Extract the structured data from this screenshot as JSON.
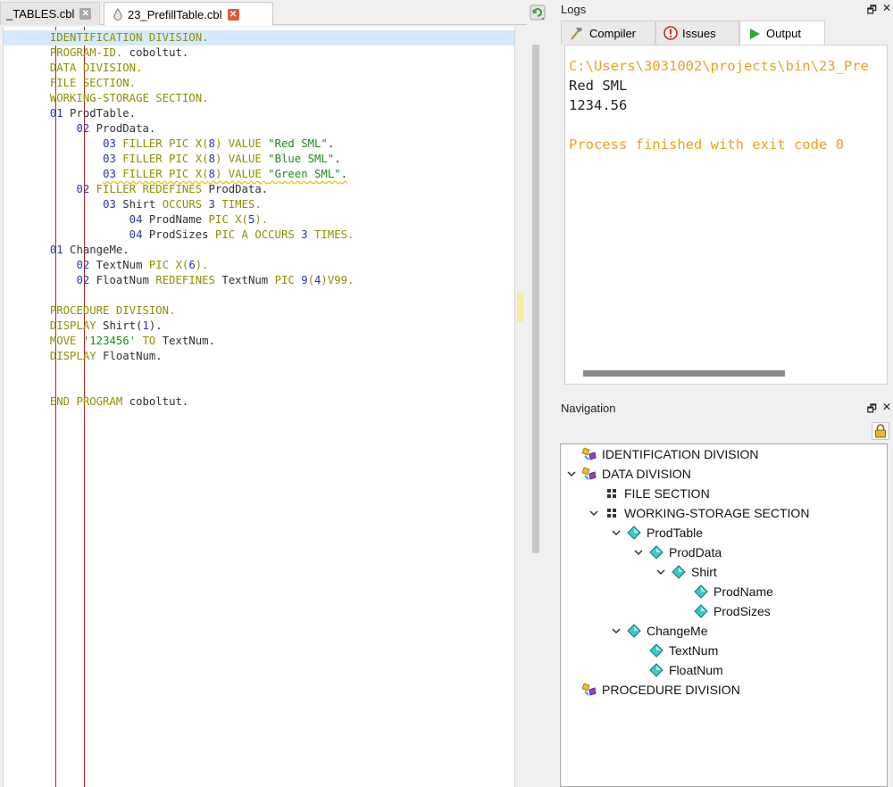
{
  "editor": {
    "tabs": [
      {
        "label": "_TABLES.cbl",
        "active": false
      },
      {
        "label": "23_PrefillTable.cbl",
        "active": true
      }
    ],
    "code": [
      {
        "tokens": [
          {
            "t": "       "
          },
          {
            "t": "IDENTIFICATION DIVISION.",
            "c": "kw"
          }
        ],
        "current": true
      },
      {
        "tokens": [
          {
            "t": "       "
          },
          {
            "t": "PROGRAM-ID.",
            "c": "kw"
          },
          {
            "t": " coboltut.",
            "c": "ident"
          }
        ]
      },
      {
        "tokens": [
          {
            "t": "       "
          },
          {
            "t": "DATA DIVISION.",
            "c": "kw"
          }
        ]
      },
      {
        "tokens": [
          {
            "t": "       "
          },
          {
            "t": "FILE SECTION.",
            "c": "kw"
          }
        ]
      },
      {
        "tokens": [
          {
            "t": "       "
          },
          {
            "t": "WORKING-STORAGE SECTION.",
            "c": "kw"
          }
        ]
      },
      {
        "tokens": [
          {
            "t": "       "
          },
          {
            "t": "01",
            "c": "num"
          },
          {
            "t": " ProdTable.",
            "c": "ident"
          }
        ]
      },
      {
        "tokens": [
          {
            "t": "           "
          },
          {
            "t": "02",
            "c": "num"
          },
          {
            "t": " ProdData.",
            "c": "ident"
          }
        ]
      },
      {
        "tokens": [
          {
            "t": "               "
          },
          {
            "t": "03",
            "c": "num"
          },
          {
            "t": " FILLER PIC X(",
            "c": "kw"
          },
          {
            "t": "8",
            "c": "num"
          },
          {
            "t": ") VALUE ",
            "c": "kw"
          },
          {
            "t": "\"Red SML\"",
            "c": "str"
          },
          {
            "t": ".",
            "c": "ident"
          }
        ]
      },
      {
        "tokens": [
          {
            "t": "               "
          },
          {
            "t": "03",
            "c": "num"
          },
          {
            "t": " FILLER PIC X(",
            "c": "kw"
          },
          {
            "t": "8",
            "c": "num"
          },
          {
            "t": ") VALUE ",
            "c": "kw"
          },
          {
            "t": "\"Blue SML\"",
            "c": "str"
          },
          {
            "t": ".",
            "c": "ident"
          }
        ]
      },
      {
        "tokens": [
          {
            "t": "               "
          },
          {
            "t": "03",
            "c": "num"
          },
          {
            "t": " FILLER PIC X(",
            "c": "kw"
          },
          {
            "t": "8",
            "c": "num"
          },
          {
            "t": ") VALUE ",
            "c": "kw"
          },
          {
            "t": "\"Green SML\"",
            "c": "str"
          },
          {
            "t": ".",
            "c": "ident"
          }
        ],
        "wavy": true
      },
      {
        "tokens": [
          {
            "t": "           "
          },
          {
            "t": "02",
            "c": "num"
          },
          {
            "t": " FILLER REDEFINES",
            "c": "kw"
          },
          {
            "t": " ProdData.",
            "c": "ident"
          }
        ]
      },
      {
        "tokens": [
          {
            "t": "               "
          },
          {
            "t": "03",
            "c": "num"
          },
          {
            "t": " Shirt ",
            "c": "ident"
          },
          {
            "t": "OCCURS ",
            "c": "kw"
          },
          {
            "t": "3",
            "c": "num"
          },
          {
            "t": " TIMES.",
            "c": "kw"
          }
        ]
      },
      {
        "tokens": [
          {
            "t": "                   "
          },
          {
            "t": "04",
            "c": "num"
          },
          {
            "t": " ProdName ",
            "c": "ident"
          },
          {
            "t": "PIC X(",
            "c": "kw"
          },
          {
            "t": "5",
            "c": "num"
          },
          {
            "t": ").",
            "c": "kw"
          }
        ]
      },
      {
        "tokens": [
          {
            "t": "                   "
          },
          {
            "t": "04",
            "c": "num"
          },
          {
            "t": " ProdSizes ",
            "c": "ident"
          },
          {
            "t": "PIC A OCCURS ",
            "c": "kw"
          },
          {
            "t": "3",
            "c": "num"
          },
          {
            "t": " TIMES.",
            "c": "kw"
          }
        ]
      },
      {
        "tokens": [
          {
            "t": "       "
          },
          {
            "t": "01",
            "c": "num"
          },
          {
            "t": " ChangeMe.",
            "c": "ident"
          }
        ]
      },
      {
        "tokens": [
          {
            "t": "           "
          },
          {
            "t": "02",
            "c": "num"
          },
          {
            "t": " TextNum ",
            "c": "ident"
          },
          {
            "t": "PIC X(",
            "c": "kw"
          },
          {
            "t": "6",
            "c": "num"
          },
          {
            "t": ").",
            "c": "kw"
          }
        ]
      },
      {
        "tokens": [
          {
            "t": "           "
          },
          {
            "t": "02",
            "c": "num"
          },
          {
            "t": " FloatNum ",
            "c": "ident"
          },
          {
            "t": "REDEFINES",
            "c": "kw"
          },
          {
            "t": " TextNum ",
            "c": "ident"
          },
          {
            "t": "PIC ",
            "c": "kw"
          },
          {
            "t": "9",
            "c": "num"
          },
          {
            "t": "(",
            "c": "kw"
          },
          {
            "t": "4",
            "c": "num"
          },
          {
            "t": ")V99.",
            "c": "kw"
          }
        ]
      },
      {
        "tokens": [
          {
            "t": ""
          }
        ]
      },
      {
        "tokens": [
          {
            "t": "       "
          },
          {
            "t": "PROCEDURE DIVISION.",
            "c": "kw"
          }
        ]
      },
      {
        "tokens": [
          {
            "t": "       "
          },
          {
            "t": "DISPLAY",
            "c": "kw"
          },
          {
            "t": " Shirt(",
            "c": "ident"
          },
          {
            "t": "1",
            "c": "num"
          },
          {
            "t": ").",
            "c": "ident"
          }
        ]
      },
      {
        "tokens": [
          {
            "t": "       "
          },
          {
            "t": "MOVE ",
            "c": "kw"
          },
          {
            "t": "'123456'",
            "c": "str"
          },
          {
            "t": " TO",
            "c": "kw"
          },
          {
            "t": " TextNum.",
            "c": "ident"
          }
        ]
      },
      {
        "tokens": [
          {
            "t": "       "
          },
          {
            "t": "DISPLAY",
            "c": "kw"
          },
          {
            "t": " FloatNum.",
            "c": "ident"
          }
        ]
      },
      {
        "tokens": [
          {
            "t": ""
          }
        ]
      },
      {
        "tokens": [
          {
            "t": ""
          }
        ]
      },
      {
        "tokens": [
          {
            "t": "       "
          },
          {
            "t": "END PROGRAM",
            "c": "kw"
          },
          {
            "t": " coboltut.",
            "c": "ident"
          }
        ]
      }
    ],
    "icons": {
      "refresh": "refresh-icon",
      "file": "file-drop-icon",
      "close": "close-icon"
    }
  },
  "logs": {
    "title": "Logs",
    "tabs": [
      {
        "label": "Compiler",
        "icon": "hammer-icon"
      },
      {
        "label": "Issues",
        "icon": "alert-icon"
      },
      {
        "label": "Output",
        "icon": "play-icon",
        "active": true
      }
    ],
    "output": [
      {
        "text": "C:\\Users\\3031002\\projects\\bin\\23_Pre",
        "color": "orange"
      },
      {
        "text": "Red SML",
        "color": "black"
      },
      {
        "text": "1234.56",
        "color": "black"
      },
      {
        "text": "",
        "color": "black"
      },
      {
        "text": "Process finished with exit code 0",
        "color": "orange"
      }
    ]
  },
  "navigation": {
    "title": "Navigation",
    "tree": [
      {
        "label": "IDENTIFICATION DIVISION",
        "level": 0,
        "icon": "division-icon",
        "expanded": null
      },
      {
        "label": "DATA DIVISION",
        "level": 0,
        "icon": "division-icon",
        "expanded": true
      },
      {
        "label": "FILE SECTION",
        "level": 1,
        "icon": "section-icon",
        "expanded": null
      },
      {
        "label": "WORKING-STORAGE SECTION",
        "level": 1,
        "icon": "section-icon",
        "expanded": true
      },
      {
        "label": "ProdTable",
        "level": 2,
        "icon": "field-icon",
        "expanded": true
      },
      {
        "label": "ProdData",
        "level": 3,
        "icon": "field-icon",
        "expanded": true
      },
      {
        "label": "Shirt",
        "level": 4,
        "icon": "field-icon",
        "expanded": true
      },
      {
        "label": "ProdName",
        "level": 5,
        "icon": "field-icon",
        "expanded": null
      },
      {
        "label": "ProdSizes",
        "level": 5,
        "icon": "field-icon",
        "expanded": null
      },
      {
        "label": "ChangeMe",
        "level": 2,
        "icon": "field-icon",
        "expanded": true
      },
      {
        "label": "TextNum",
        "level": 3,
        "icon": "field-icon",
        "expanded": null
      },
      {
        "label": "FloatNum",
        "level": 3,
        "icon": "field-icon",
        "expanded": null
      },
      {
        "label": "PROCEDURE DIVISION",
        "level": 0,
        "icon": "division-icon",
        "expanded": null
      }
    ]
  },
  "colors": {
    "keyword": "#8f8f00",
    "number": "#2838a8",
    "string": "#1e8a1e",
    "output_orange": "#f0a020",
    "current_line": "#d4e9fb"
  }
}
